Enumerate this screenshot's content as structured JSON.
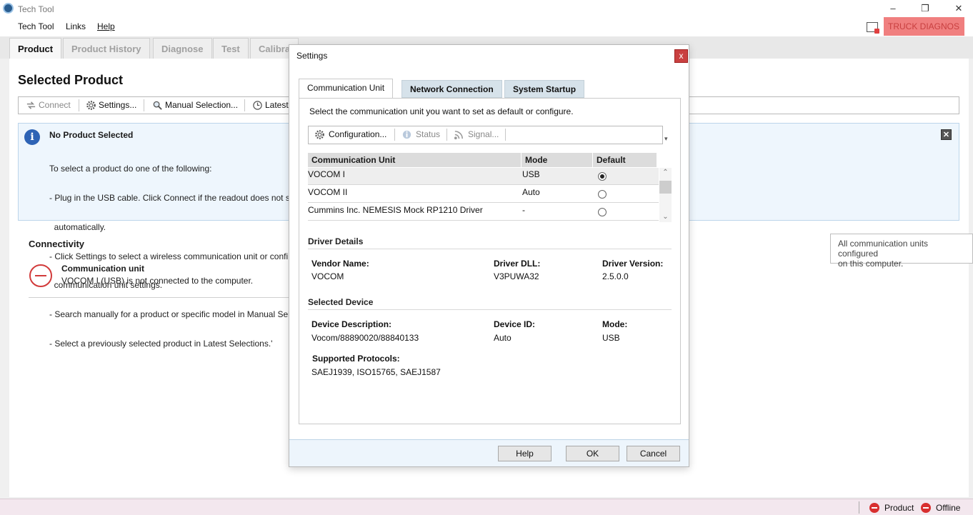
{
  "window": {
    "title": "Tech Tool"
  },
  "menu": {
    "tech_tool": "Tech Tool",
    "links": "Links",
    "help": "Help",
    "truck_diag": "TRUCK DIAGNOS"
  },
  "main_tabs": [
    "Product",
    "Product History",
    "Diagnose",
    "Test",
    "Calibra"
  ],
  "page": {
    "title": "Selected Product",
    "toolbar": {
      "connect": "Connect",
      "settings": "Settings...",
      "manual_selection": "Manual Selection...",
      "latest": "Latest"
    },
    "info": {
      "title": "No Product Selected",
      "lines": [
        "To select a product do one of the following:",
        "- Plug in the USB cable. Click Connect if the readout does not s",
        "  automatically.",
        "- Click Settings to select a wireless communication unit or confi",
        "  communication unit settings.",
        "- Search manually for a product or specific model in Manual Sel",
        "- Select a previously selected product in Latest Selections.'"
      ]
    },
    "connectivity": {
      "title": "Connectivity",
      "unit_title": "Communication unit",
      "unit_status": "VOCOM I (USB) is not connected to the computer."
    }
  },
  "tooltip": {
    "line1": "All communication units configured",
    "line2": "on this computer."
  },
  "statusbar": {
    "product": "Product",
    "offline": "Offline"
  },
  "dialog": {
    "title": "Settings",
    "close": "x",
    "tabs": [
      "Communication Unit",
      "Network Connection",
      "System Startup"
    ],
    "intro": "Select the communication unit you want to set as default or configure.",
    "toolbar": {
      "configuration": "Configuration...",
      "status": "Status",
      "signal": "Signal..."
    },
    "grid": {
      "headers": [
        "Communication Unit",
        "Mode",
        "Default"
      ],
      "rows": [
        {
          "unit": "VOCOM I",
          "mode": "USB",
          "default": true
        },
        {
          "unit": "VOCOM II",
          "mode": "Auto",
          "default": false
        },
        {
          "unit": "Cummins Inc. NEMESIS Mock RP1210 Driver",
          "mode": "-",
          "default": false
        }
      ]
    },
    "driver_details": {
      "title": "Driver Details",
      "vendor_label": "Vendor Name:",
      "vendor": "VOCOM",
      "dll_label": "Driver DLL:",
      "dll": "V3PUWA32",
      "version_label": "Driver Version:",
      "version": "2.5.0.0"
    },
    "selected_device": {
      "title": "Selected Device",
      "desc_label": "Device Description:",
      "desc": "Vocom/88890020/88840133",
      "id_label": "Device ID:",
      "id": "Auto",
      "mode_label": "Mode:",
      "mode": "USB",
      "protocols_label": "Supported Protocols:",
      "protocols": "SAEJ1939, ISO15765, SAEJ1587"
    },
    "buttons": {
      "help": "Help",
      "ok": "OK",
      "cancel": "Cancel"
    }
  },
  "colors": {
    "accent_red": "#d23b3b",
    "info_bg": "#eef6fd",
    "truck_diag_bg": "#f07f7f"
  }
}
